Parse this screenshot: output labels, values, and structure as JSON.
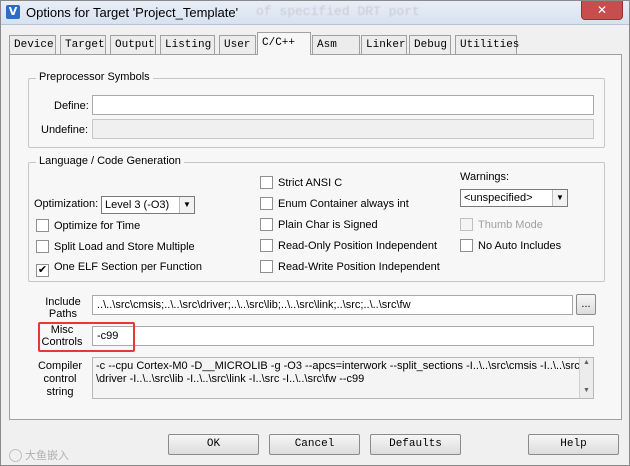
{
  "window": {
    "title": "Options for Target 'Project_Template'",
    "background_title_fragment": "of specified DRT port",
    "close_glyph": "✕",
    "app_icon": "keil-icon"
  },
  "tabs": [
    {
      "label": "Device"
    },
    {
      "label": "Target"
    },
    {
      "label": "Output"
    },
    {
      "label": "Listing"
    },
    {
      "label": "User"
    },
    {
      "label": "C/C++",
      "active": true
    },
    {
      "label": "Asm"
    },
    {
      "label": "Linker"
    },
    {
      "label": "Debug"
    },
    {
      "label": "Utilities"
    }
  ],
  "preprocessor": {
    "title": "Preprocessor Symbols",
    "define_label": "Define:",
    "define_value": "",
    "undefine_label": "Undefine:",
    "undefine_value": ""
  },
  "language": {
    "title": "Language / Code Generation",
    "optimization_label": "Optimization:",
    "optimization_value": "Level 3 (-O3)",
    "checkboxes_left": [
      {
        "label": "Optimize for Time",
        "checked": false
      },
      {
        "label": "Split Load and Store Multiple",
        "checked": false
      },
      {
        "label": "One ELF Section per Function",
        "checked": true
      }
    ],
    "checkboxes_mid": [
      {
        "label": "Strict ANSI C",
        "checked": false
      },
      {
        "label": "Enum Container always int",
        "checked": false
      },
      {
        "label": "Plain Char is Signed",
        "checked": false
      },
      {
        "label": "Read-Only Position Independent",
        "checked": false
      },
      {
        "label": "Read-Write Position Independent",
        "checked": false
      }
    ],
    "warnings_label": "Warnings:",
    "warnings_value": "<unspecified>",
    "thumb_mode": {
      "label": "Thumb Mode",
      "checked": false,
      "enabled": false
    },
    "no_auto_includes": {
      "label": "No Auto Includes",
      "checked": false
    }
  },
  "include_paths": {
    "label_line1": "Include",
    "label_line2": "Paths",
    "value": "..\\..\\src\\cmsis;..\\..\\src\\driver;..\\..\\src\\lib;..\\..\\src\\link;..\\src;..\\..\\src\\fw",
    "browse_label": "..."
  },
  "misc_controls": {
    "label_line1": "Misc",
    "label_line2": "Controls",
    "value": "-c99"
  },
  "compiler_string": {
    "label_line1": "Compiler",
    "label_line2": "control",
    "label_line3": "string",
    "line1": "-c --cpu Cortex-M0 -D__MICROLIB -g -O3 --apcs=interwork --split_sections -I..\\..\\src\\cmsis -I..\\..\\src",
    "line2": "\\driver -I..\\..\\src\\lib -I..\\..\\src\\link -I..\\src -I..\\..\\src\\fw --c99"
  },
  "buttons": {
    "ok": "OK",
    "cancel": "Cancel",
    "defaults": "Defaults",
    "help": "Help"
  },
  "watermark": "大鱼嵌入",
  "colors": {
    "highlight": "#e53935",
    "close_button": "#c74e4e",
    "app_icon": "#2b6cc4"
  }
}
